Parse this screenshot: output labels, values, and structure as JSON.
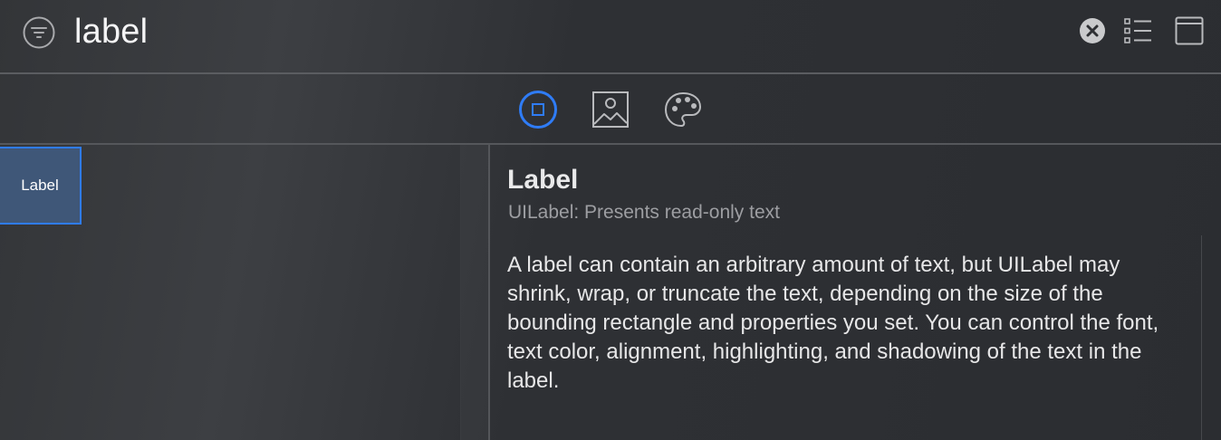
{
  "search": {
    "query": "label"
  },
  "icons": {
    "filter": "filter-icon",
    "clear": "clear-icon",
    "list_view": "list-view-icon",
    "window": "window-icon",
    "objects": "objects-icon",
    "media": "image-icon",
    "colors": "palette-icon"
  },
  "segments": {
    "selected": "objects"
  },
  "library": {
    "items": [
      {
        "label": "Label"
      }
    ]
  },
  "detail": {
    "title": "Label",
    "subtitle": "UILabel: Presents read-only text",
    "description": "A label can contain an arbitrary amount of text, but UILabel may shrink, wrap, or truncate the text, depending on the size of the bounding rectangle and properties you set. You can control the font, text color, alignment, highlighting, and shadowing of the text in the label."
  },
  "colors": {
    "accent": "#2f7cf6",
    "background": "#2e3034",
    "tile_selected": "#3f5778"
  }
}
